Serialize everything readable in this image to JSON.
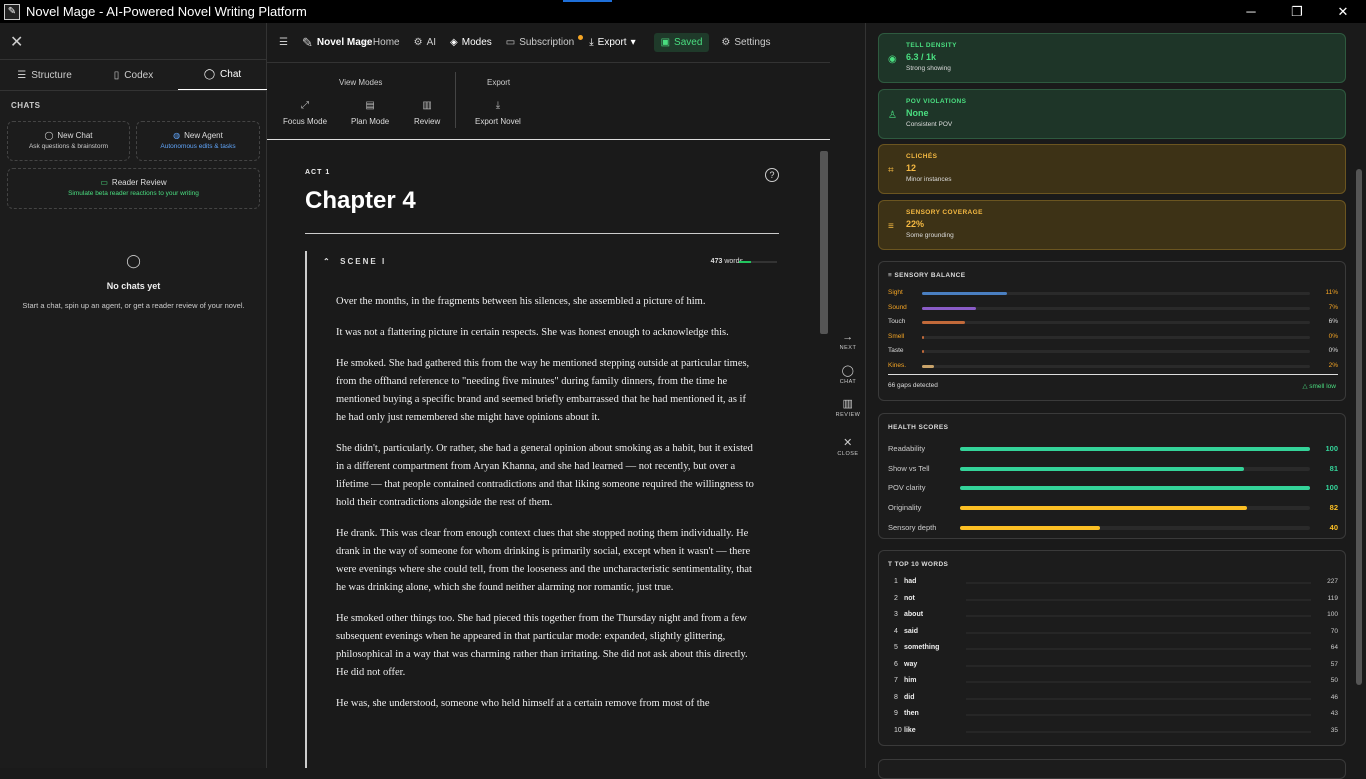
{
  "window": {
    "title": "Novel Mage - AI-Powered Novel Writing Platform",
    "minimize": "─",
    "maximize": "❐",
    "close": "✕"
  },
  "left": {
    "tabs": [
      {
        "label": "Structure",
        "icon": "list-icon"
      },
      {
        "label": "Codex",
        "icon": "book-icon"
      },
      {
        "label": "Chat",
        "icon": "chat-icon"
      }
    ],
    "section": "CHATS",
    "new_chat": {
      "title": "New Chat",
      "sub": "Ask questions & brainstorm"
    },
    "new_agent": {
      "title": "New Agent",
      "sub": "Autonomous edits & tasks"
    },
    "reader_review": {
      "title": "Reader Review",
      "sub": "Simulate beta reader reactions to your writing"
    },
    "empty": {
      "title": "No chats yet",
      "text": "Start a chat, spin up an agent, or get a reader review of your novel."
    }
  },
  "nav": {
    "brand": "Novel Mage",
    "home": "Home",
    "ai": "AI",
    "modes": "Modes",
    "subscription": "Subscription",
    "export": "Export",
    "saved": "Saved",
    "settings": "Settings"
  },
  "ribbon": {
    "view_modes": "View Modes",
    "export": "Export",
    "focus": "Focus Mode",
    "plan": "Plan Mode",
    "review": "Review",
    "export_novel": "Export Novel"
  },
  "doc": {
    "act": "ACT 1",
    "chapter": "Chapter 4",
    "scene": "SCENE I",
    "words": "473",
    "words_label": "words",
    "paragraphs": [
      "Over the months, in the fragments between his silences, she assembled a picture of him.",
      "It was not a flattering picture in certain respects. She was honest enough to acknowledge this.",
      "He smoked. She had gathered this from the way he mentioned stepping outside at particular times, from the offhand reference to \"needing five minutes\" during family dinners, from the time he mentioned buying a specific brand and seemed briefly embarrassed that he had mentioned it, as if he had only just remembered she might have opinions about it.",
      "She didn't, particularly. Or rather, she had a general opinion about smoking as a habit, but it existed in a different compartment from Aryan Khanna, and she had learned — not recently, but over a lifetime — that people contained contradictions and that liking someone required the willingness to hold their contradictions alongside the rest of them.",
      "He drank. This was clear from enough context clues that she stopped noting them individually. He drank in the way of someone for whom drinking is primarily social, except when it wasn't — there were evenings where she could tell, from the looseness and the uncharacteristic sentimentality, that he was drinking alone, which she found neither alarming nor romantic, just true.",
      "He smoked other things too. She had pieced this together from the Thursday night and from a few subsequent evenings when he appeared in that particular mode: expanded, slightly glittering, philosophical in a way that was charming rather than irritating. She did not ask about this directly. He did not offer.",
      "He was, she understood, someone who held himself at a certain remove from most of the"
    ]
  },
  "side": {
    "next": "NEXT",
    "chat": "CHAT",
    "review": "REVIEW",
    "close": "CLOSE"
  },
  "metrics": [
    {
      "label": "TELL DENSITY",
      "value": "6.3 / 1k",
      "sub": "Strong showing",
      "icon": "eye-icon",
      "color": "green"
    },
    {
      "label": "POV VIOLATIONS",
      "value": "None",
      "sub": "Consistent POV",
      "icon": "person-icon",
      "color": "green"
    },
    {
      "label": "CLICHÉS",
      "value": "12",
      "sub": "Minor instances",
      "icon": "tag-icon",
      "color": "yellow"
    },
    {
      "label": "SENSORY COVERAGE",
      "value": "22%",
      "sub": "Some grounding",
      "icon": "layers-icon",
      "color": "yellow"
    }
  ],
  "sensory": {
    "title": "SENSORY BALANCE",
    "gaps": "66 gaps detected",
    "low": "smell low",
    "rows": [
      {
        "name": "Sight",
        "pct": "11%",
        "value": 0.22,
        "color": "#4a7fc1",
        "text": "#f5a524"
      },
      {
        "name": "Sound",
        "pct": "7%",
        "value": 0.14,
        "color": "#8a5cc7",
        "text": "#f5a524"
      },
      {
        "name": "Touch",
        "pct": "6%",
        "value": 0.11,
        "color": "#c26a3a",
        "text": "#ddd"
      },
      {
        "name": "Smell",
        "pct": "0%",
        "value": 0.0,
        "color": "#c26a3a",
        "text": "#f5a524"
      },
      {
        "name": "Taste",
        "pct": "0%",
        "value": 0.0,
        "color": "#c26a3a",
        "text": "#ddd"
      },
      {
        "name": "Kines.",
        "pct": "2%",
        "value": 0.03,
        "color": "#c9a36a",
        "text": "#f5a524"
      }
    ]
  },
  "health": {
    "title": "HEALTH SCORES",
    "rows": [
      {
        "name": "Readability",
        "score": "100",
        "value": 1.0,
        "color": "#34d399"
      },
      {
        "name": "Show vs Tell",
        "score": "81",
        "value": 0.81,
        "color": "#34d399"
      },
      {
        "name": "POV clarity",
        "score": "100",
        "value": 1.0,
        "color": "#34d399"
      },
      {
        "name": "Originality",
        "score": "82",
        "value": 0.82,
        "color": "#fbbf24"
      },
      {
        "name": "Sensory depth",
        "score": "40",
        "value": 0.4,
        "color": "#fbbf24"
      }
    ]
  },
  "words": {
    "title": "TOP 10 WORDS",
    "rows": [
      {
        "rank": "1",
        "word": "had",
        "count": "227"
      },
      {
        "rank": "2",
        "word": "not",
        "count": "119"
      },
      {
        "rank": "3",
        "word": "about",
        "count": "100"
      },
      {
        "rank": "4",
        "word": "said",
        "count": "70"
      },
      {
        "rank": "5",
        "word": "something",
        "count": "64"
      },
      {
        "rank": "6",
        "word": "way",
        "count": "57"
      },
      {
        "rank": "7",
        "word": "him",
        "count": "50"
      },
      {
        "rank": "8",
        "word": "did",
        "count": "46"
      },
      {
        "rank": "9",
        "word": "then",
        "count": "43"
      },
      {
        "rank": "10",
        "word": "like",
        "count": "35"
      }
    ]
  }
}
